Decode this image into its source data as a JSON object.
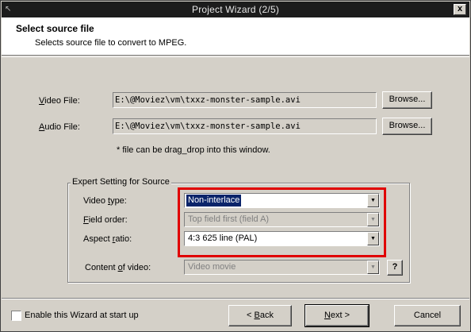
{
  "window": {
    "title": "Project Wizard (2/5)",
    "close_glyph": "x",
    "system_glyph": "↖"
  },
  "header": {
    "title": "Select source file",
    "subtitle": "Selects source file to convert to MPEG."
  },
  "video_file": {
    "label_first": "V",
    "label_rest": "ideo File:",
    "value": "E:\\@Moviez\\vm\\txxz-monster-sample.avi",
    "browse_label": "Browse..."
  },
  "audio_file": {
    "label_first": "A",
    "label_rest": "udio File:",
    "value": "E:\\@Moviez\\vm\\txxz-monster-sample.avi",
    "browse_label": "Browse..."
  },
  "hint": "* file can be drag_drop into this window.",
  "expert": {
    "group_title": "Expert Setting for Source",
    "video_type": {
      "label_pre": "Video ",
      "label_ul": "t",
      "label_post": "ype:",
      "value": "Non-interlace",
      "enabled": true,
      "focused": true
    },
    "field_order": {
      "label_ul": "F",
      "label_post": "ield order:",
      "value": "Top field first (field A)",
      "enabled": false
    },
    "aspect_ratio": {
      "label_pre": "Aspect ",
      "label_ul": "r",
      "label_post": "atio:",
      "value": "4:3 625 line (PAL)",
      "enabled": true
    },
    "content_of_video": {
      "label_pre": "Content ",
      "label_ul": "o",
      "label_post": "f video:",
      "value": "Video movie",
      "enabled": false,
      "help_label": "?"
    }
  },
  "footer": {
    "checkbox_label": "Enable this Wizard at start up",
    "checkbox_checked": false,
    "back_arrow": "< ",
    "back_ul": "B",
    "back_rest": "ack",
    "next_ul": "N",
    "next_rest": "ext >",
    "cancel_label": "Cancel"
  },
  "colors": {
    "highlight_border": "#e00000",
    "selection": "#0a246a",
    "dialog_bg": "#d4d0c8"
  }
}
